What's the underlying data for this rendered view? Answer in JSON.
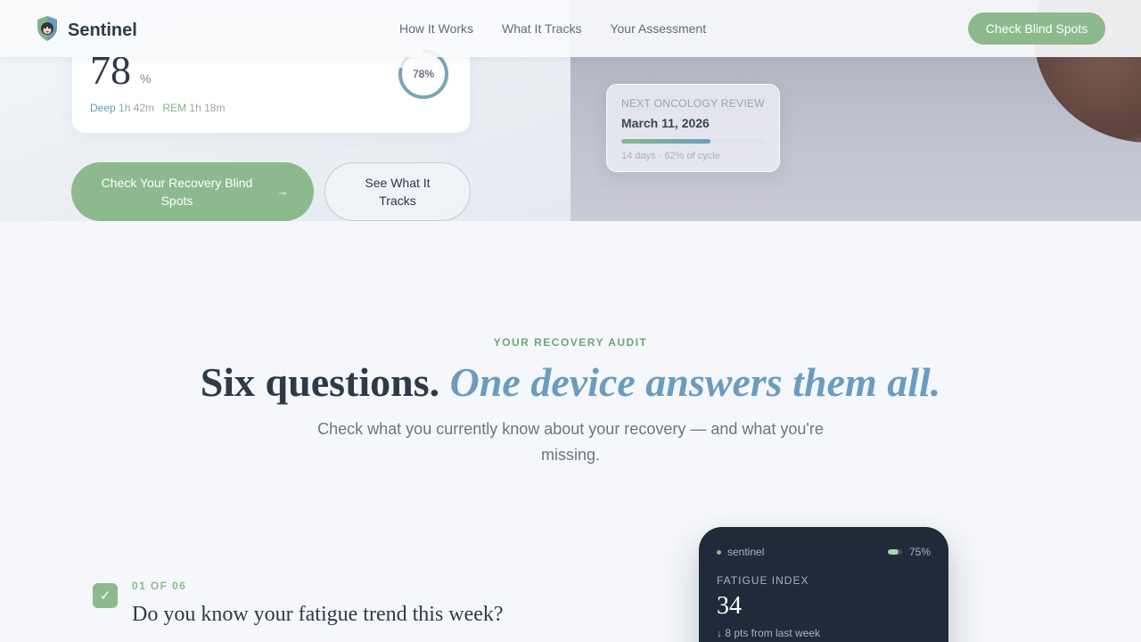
{
  "colors": {
    "accent_green": "#8cba8e",
    "accent_blue": "#6b9cc0",
    "text_dark": "#2e3a47",
    "device_bg": "#1f2a3b"
  },
  "nav": {
    "brand": "Sentinel",
    "logo_icon": "shield-monkey-icon",
    "links": [
      "How It Works",
      "What It Tracks",
      "Your Assessment"
    ],
    "cta": "Check Blind Spots"
  },
  "hero": {
    "sleep_card": {
      "value": "78",
      "unit": "%",
      "ring_label": "78%",
      "ring_progress": 0.78,
      "deep_label": "Deep",
      "deep_value": "1h 42m",
      "rem_label": "REM",
      "rem_value": "1h 18m"
    },
    "primary_button": "Check Your Recovery Blind Spots",
    "primary_button_icon": "arrow-right-icon",
    "secondary_button": "See What It Tracks",
    "review_card": {
      "label": "NEXT ONCOLOGY REVIEW",
      "date": "March 11, 2026",
      "progress": 0.62,
      "days": "14 days",
      "cycle": "62% of cycle"
    }
  },
  "audit": {
    "eyebrow": "YOUR RECOVERY AUDIT",
    "headline_plain": "Six questions.",
    "headline_accent": "One device answers them all.",
    "subhead": "Check what you currently know about your recovery — and what you're missing.",
    "question": {
      "index": "01 OF 06",
      "text": "Do you know your fatigue trend this week?",
      "checked": true
    },
    "device": {
      "brand": "sentinel",
      "battery": "75%",
      "battery_level": 0.75,
      "metric_label": "FATIGUE INDEX",
      "metric_value": "34",
      "delta": "↓ 8 pts from last week"
    }
  }
}
